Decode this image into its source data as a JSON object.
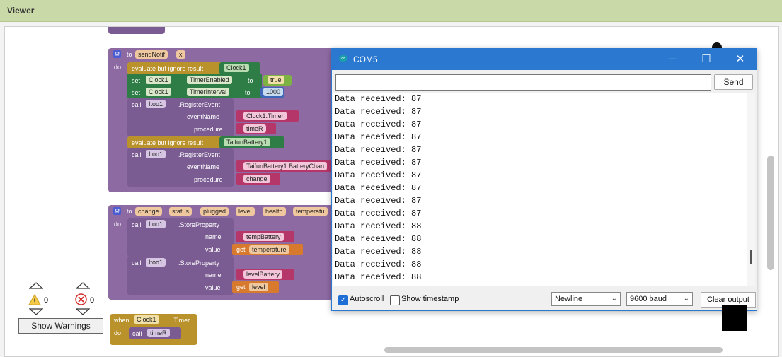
{
  "viewer": {
    "title": "Viewer"
  },
  "blocks": {
    "sendnotif": {
      "to": "to",
      "name": "sendNotif",
      "close": "x",
      "do": "do",
      "evaluate1": "evaluate but ignore result",
      "clock_ref": "Clock1",
      "set": "set",
      "clock1a": "Clock1",
      "timer_enabled": "TimerEnabled",
      "to1": "to",
      "true_val": "true",
      "clock1b": "Clock1",
      "timer_interval": "TimerInterval",
      "to2": "to",
      "interval_val": "1000",
      "call": "call",
      "itoo": "Itoo1",
      "register": ".RegisterEvent",
      "event_name_label": "eventName",
      "event_name": "Clock1.Timer",
      "procedure_label": "procedure",
      "procedure": "timeR",
      "evaluate2": "evaluate but ignore result",
      "battery_ref": "TaifunBattery1",
      "event_name2": "TaifunBattery1.BatteryChan",
      "procedure2": "change"
    },
    "change": {
      "to": "to",
      "name": "change",
      "params": [
        "status",
        "plugged",
        "level",
        "health",
        "temperatu"
      ],
      "do": "do",
      "call": "call",
      "itoo": "Itoo1",
      "store": ".StoreProperty",
      "name_label": "name",
      "value_label": "value",
      "name1": "tempBattery",
      "get": "get",
      "value1": "temperature",
      "name2": "levelBattery",
      "value2": "level"
    },
    "timer": {
      "when": "when",
      "clock": "Clock1",
      "event": ".Timer",
      "do": "do",
      "call": "call",
      "proc": "timeR"
    }
  },
  "warnings": {
    "warn_count": "0",
    "error_count": "0",
    "button": "Show Warnings"
  },
  "serial": {
    "title": "COM5",
    "input_value": "",
    "send": "Send",
    "lines": [
      "Data received: 87",
      "Data received: 87",
      "Data received: 87",
      "Data received: 87",
      "Data received: 87",
      "Data received: 87",
      "Data received: 87",
      "Data received: 87",
      "Data received: 87",
      "Data received: 87",
      "Data received: 88",
      "Data received: 88",
      "Data received: 88",
      "Data received: 88",
      "Data received: 88"
    ],
    "autoscroll": "Autoscroll",
    "timestamp": "Show timestamp",
    "line_ending": "Newline",
    "baud": "9600 baud",
    "clear": "Clear output"
  }
}
